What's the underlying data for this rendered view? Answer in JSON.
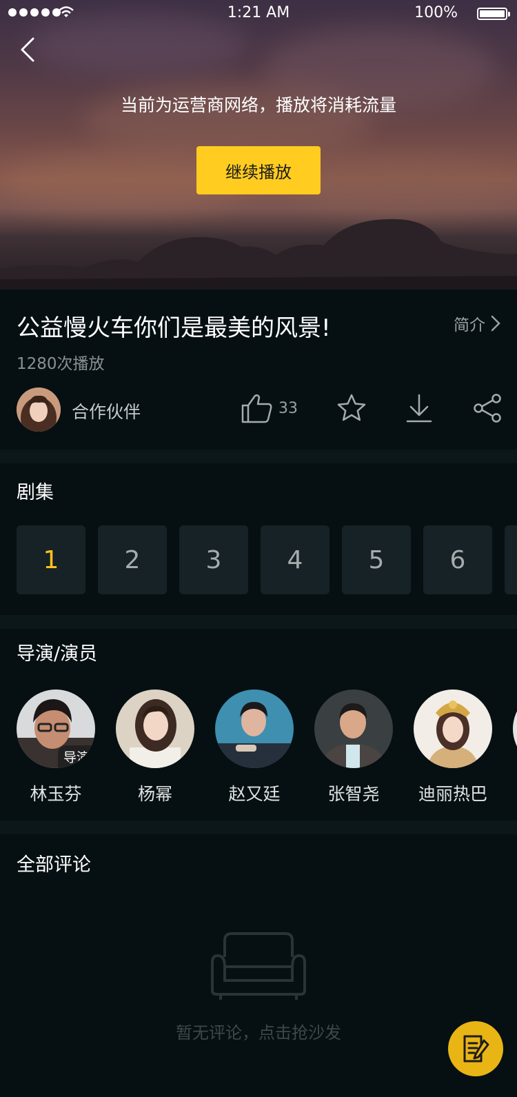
{
  "status_bar": {
    "time": "1:21 AM",
    "battery": "100%"
  },
  "player": {
    "network_notice": "当前为运营商网络，播放将消耗流量",
    "continue_button": "继续播放"
  },
  "video": {
    "title": "公益慢火车你们是最美的风景!",
    "intro_link": "简介",
    "play_count": "1280次播放",
    "uploader": "合作伙伴",
    "like_count": "33"
  },
  "episodes": {
    "title": "剧集",
    "items": [
      "1",
      "2",
      "3",
      "4",
      "5",
      "6"
    ],
    "active_index": 0
  },
  "cast": {
    "title": "导演/演员",
    "members": [
      {
        "name": "林玉芬",
        "role": "导演"
      },
      {
        "name": "杨幂"
      },
      {
        "name": "赵又廷"
      },
      {
        "name": "张智尧"
      },
      {
        "name": "迪丽热巴"
      }
    ]
  },
  "comments": {
    "title": "全部评论",
    "empty_text": "暂无评论，点击抢沙发"
  },
  "colors": {
    "accent": "#ffcc1f",
    "background": "#061013",
    "tile": "#162225"
  }
}
